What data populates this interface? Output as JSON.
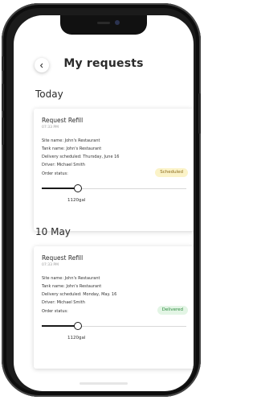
{
  "header": {
    "title": "My requests",
    "back_icon": "chevron-left-icon"
  },
  "sections": [
    {
      "heading": "Today",
      "card": {
        "title": "Request Refill",
        "time": "07:33 PM",
        "details": [
          "Site name: John's Restaurant",
          "Tank name: John's Restaurant",
          "Delivery scheduled: Thursday, June 16",
          "Driver: Michael Smith"
        ],
        "status_label": "Order status:",
        "status": "Scheduled",
        "status_color": "#fbf3c8",
        "level_fraction": 0.25,
        "level_value": "1120gal"
      }
    },
    {
      "heading": "10 May",
      "card": {
        "title": "Request Refill",
        "time": "07:33 PM",
        "details": [
          "Site name: John's Restaurant",
          "Tank name: John's Restaurant",
          "Delivery scheduled: Monday, May. 16",
          "Driver: Michael Smith"
        ],
        "status_label": "Order status:",
        "status": "Delivered",
        "status_color": "#e3f5e5",
        "level_fraction": 0.25,
        "level_value": "1120gal"
      }
    }
  ]
}
